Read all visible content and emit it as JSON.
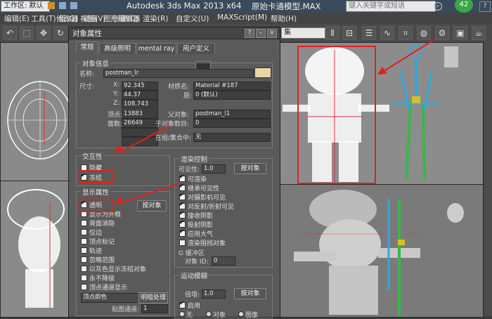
{
  "titlebar": {
    "workspace_label": "工作区: 默认",
    "app_title": "Autodesk 3ds Max  2013 x64",
    "file_title": "原始卡通模型.MAX",
    "search_placeholder": "键入关键字或短语",
    "badge": "42"
  },
  "menubar": {
    "items": [
      "编辑(E)",
      "工具(T)",
      "组(G)",
      "视图(V)",
      "创建(C)",
      "修改器",
      "动画",
      "图形编辑器",
      "渲染(R)",
      "自定义(U)",
      "MAXScript(M)",
      "帮助(H)"
    ]
  },
  "toolbar": {
    "selection_set": "集"
  },
  "dialog": {
    "title": "对象属性",
    "tabs": [
      "常规",
      "高级照明",
      "mental ray",
      "用户定义"
    ],
    "object_info": {
      "group_label": "对象信息",
      "name_label": "名称:",
      "name_value": "postman_lr",
      "dims_label": "尺寸:",
      "x_label": "X:",
      "x_value": "92.345",
      "y_label": "Y:",
      "y_value": "44.37",
      "z_label": "Z:",
      "z_value": "108.743",
      "verts_label": "顶点:",
      "verts_value": "13883",
      "faces_label": "面数:",
      "faces_value": "26649",
      "material_label": "材质名:",
      "material_value": "Material #187",
      "layer_label": "层:",
      "layer_value": "0 (默认)",
      "parent_label": "父对象:",
      "parent_value": "postman_l1",
      "children_label": "子对象数目:",
      "children_value": "0",
      "group_member_label": "在组/集合中:",
      "group_member_value": "无"
    },
    "interactivity": {
      "group_label": "交互性",
      "hide_label": "隐藏",
      "freeze_label": "冻结"
    },
    "display_props": {
      "group_label": "显示属性",
      "by_object_button": "按对象",
      "items": [
        {
          "label": "透明",
          "checked": true
        },
        {
          "label": "显示为外框",
          "checked": false
        },
        {
          "label": "背面消隐",
          "checked": false
        },
        {
          "label": "仅边",
          "checked": false
        },
        {
          "label": "顶点标记",
          "checked": false
        },
        {
          "label": "轨迹",
          "checked": false
        },
        {
          "label": "忽略范围",
          "checked": false
        },
        {
          "label": "以灰色显示冻结对象",
          "checked": false
        },
        {
          "label": "永不降级",
          "checked": false
        },
        {
          "label": "顶点通道显示",
          "checked": false
        }
      ],
      "vertex_color_select": "顶点颜色",
      "shaded_button": "明暗处理",
      "map_channel_label": "贴图通道:",
      "map_channel_value": "1"
    },
    "render_control": {
      "group_label": "渲染控制",
      "visibility_label": "可见性:",
      "visibility_value": "1.0",
      "by_object_button": "按对象",
      "items": [
        {
          "label": "可渲染",
          "checked": true
        },
        {
          "label": "继承可见性",
          "checked": true
        },
        {
          "label": "对摄影机可见",
          "checked": true
        },
        {
          "label": "对反射/折射可见",
          "checked": true
        },
        {
          "label": "接收阴影",
          "checked": true
        },
        {
          "label": "投射阴影",
          "checked": true
        },
        {
          "label": "应用大气",
          "checked": true
        },
        {
          "label": "渲染阻挡对象",
          "checked": false
        }
      ],
      "gbuffer_label": "G 缓冲区",
      "object_id_label": "对象 ID:",
      "object_id_value": "0"
    },
    "motion_blur": {
      "group_label": "运动模糊",
      "multiplier_label": "倍增:",
      "multiplier_value": "1.0",
      "by_object_button": "按对象",
      "enabled_label": "启用",
      "enabled_checked": true,
      "none_label": "无",
      "object_label": "对象",
      "image_label": "图像"
    }
  }
}
